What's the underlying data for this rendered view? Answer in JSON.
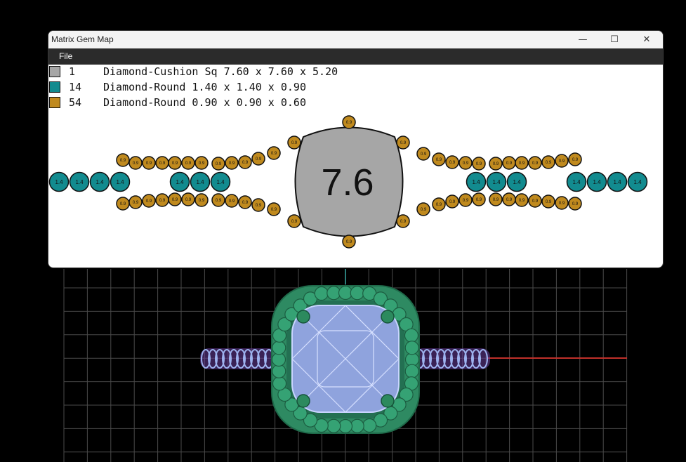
{
  "window": {
    "title": "Matrix Gem Map",
    "controls": {
      "minimize": "—",
      "maximize": "☐",
      "close": "✕"
    },
    "menu": {
      "file": "File"
    }
  },
  "legend": [
    {
      "count": "1",
      "description": "Diamond-Cushion Sq 7.60 x 7.60 x 5.20",
      "color": "#a6a6a6"
    },
    {
      "count": "14",
      "description": "Diamond-Round 1.40 x 1.40 x 0.90",
      "color": "#128b8f"
    },
    {
      "count": "54",
      "description": "Diamond-Round 0.90 x 0.90 x 0.60",
      "color": "#c08a1e"
    }
  ],
  "gem_map": {
    "center_label": "7.6",
    "medium_label": "1.4",
    "small_label": "0.9",
    "center_color": "#a6a6a6",
    "medium_color": "#128b8f",
    "small_color": "#c08a1e"
  },
  "viewport": {
    "background": "#000000",
    "grid_color": "#4a4a4a",
    "axis_x_color": "#c0302a",
    "axis_y_color": "#2a7d7a",
    "halo_color": "#2e8a62",
    "center_stone_color": "#8fa3dd",
    "shank_color": "#9db2ee"
  }
}
